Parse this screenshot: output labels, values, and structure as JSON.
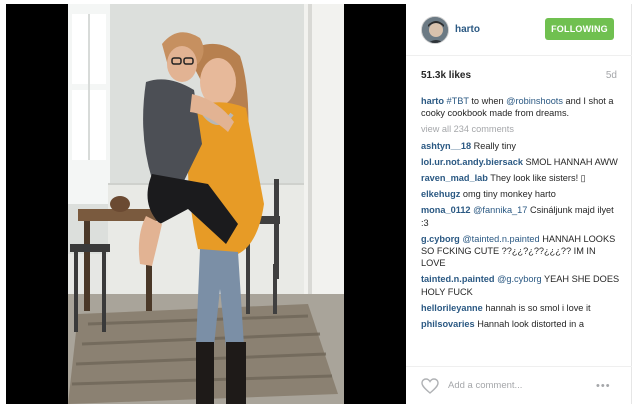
{
  "post": {
    "username": "harto",
    "follow_label": "FOLLOWING",
    "likes": "51.3k likes",
    "age": "5d",
    "caption": {
      "user": "harto",
      "hashtag": "#TBT",
      "text_a": " to when ",
      "mention": "@robinshoots",
      "text_b": " and I shot a cooky cookbook made from dreams."
    },
    "view_all": "view all 234 comments",
    "comments": [
      {
        "user": "ashtyn__18",
        "text": "Really tiny"
      },
      {
        "user": "lol.ur.not.andy.biersack",
        "text": "SMOL HANNAH AWW"
      },
      {
        "user": "raven_mad_lab",
        "text": "They look like sisters! ▯"
      },
      {
        "user": "elkehugz",
        "text": "omg tiny monkey harto"
      },
      {
        "user": "mona_0112",
        "mention": "@fannika_17",
        "text": "Csináljunk majd ilyet :3"
      },
      {
        "user": "g.cyborg",
        "mention": "@tainted.n.painted",
        "text": "HANNAH LOOKS SO FCKING CUTE ??¿¿?¿??¿¿¿?? IM IN LOVE"
      },
      {
        "user": "tainted.n.painted",
        "mention": "@g.cyborg",
        "text": "YEAH SHE DOES HOLY FUCK"
      },
      {
        "user": "hellorileyanne",
        "text": "hannah is so smol i love it"
      },
      {
        "user": "philsovaries",
        "text": "Hannah look distorted in a"
      }
    ],
    "add_comment_placeholder": "Add a comment...",
    "more_label": "•••"
  },
  "colors": {
    "link": "#2b5983",
    "follow_bg": "#70c050",
    "muted": "#a5a7aa"
  },
  "icons": [
    "heart-icon",
    "more-options-icon",
    "avatar"
  ]
}
